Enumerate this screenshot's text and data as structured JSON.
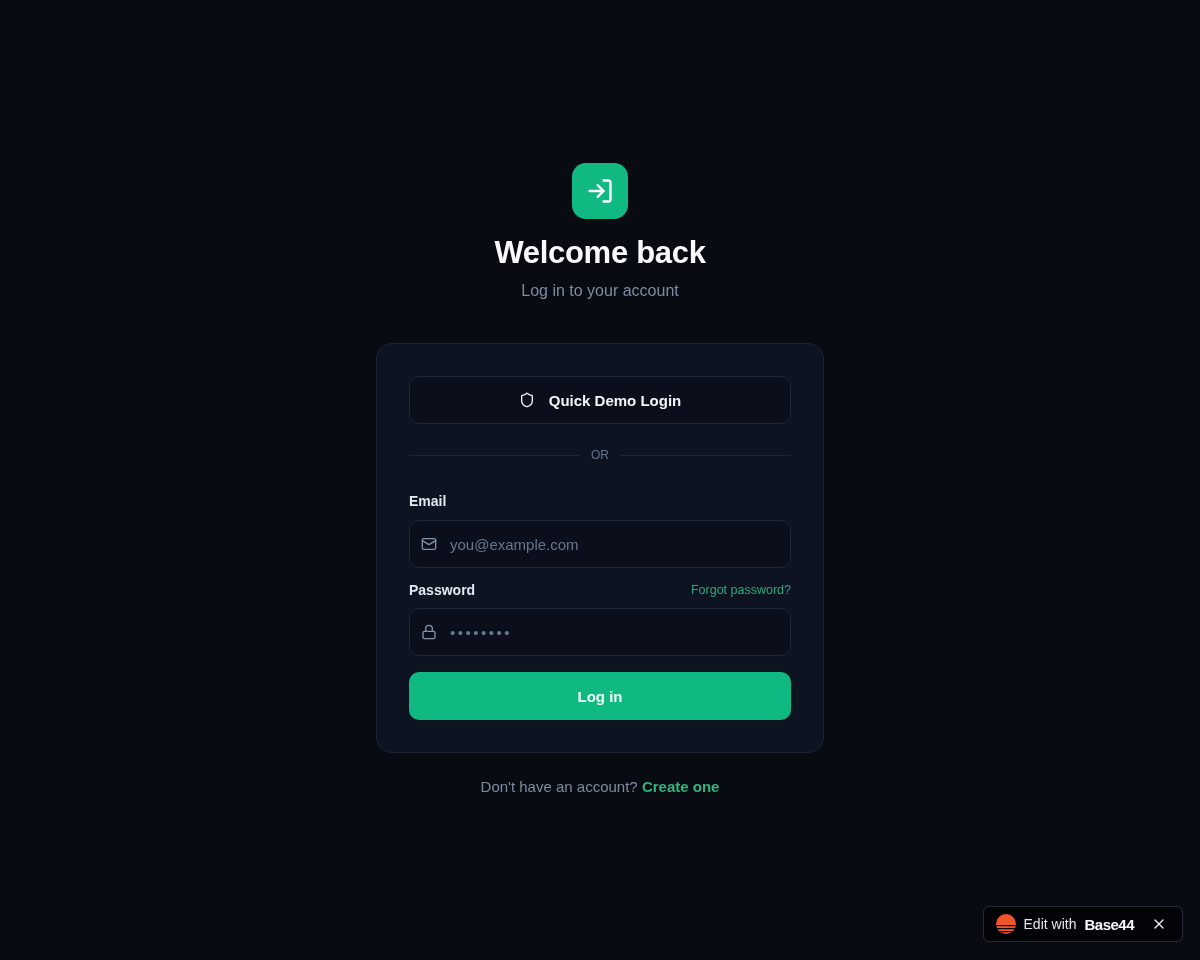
{
  "header": {
    "title": "Welcome back",
    "subtitle": "Log in to your account"
  },
  "demo_button": {
    "label": "Quick Demo Login"
  },
  "divider": {
    "label": "OR"
  },
  "fields": [
    {
      "kind": "email",
      "label": "Email",
      "placeholder": "you@example.com"
    },
    {
      "kind": "password",
      "label": "Password",
      "link": "Forgot password?",
      "placeholder": "••••••••"
    }
  ],
  "submit_button": {
    "label": "Log in"
  },
  "footer": {
    "text": "Don't have an account?",
    "link": "Create one"
  },
  "badge": {
    "label": "Edit with",
    "brand": "Base44"
  }
}
